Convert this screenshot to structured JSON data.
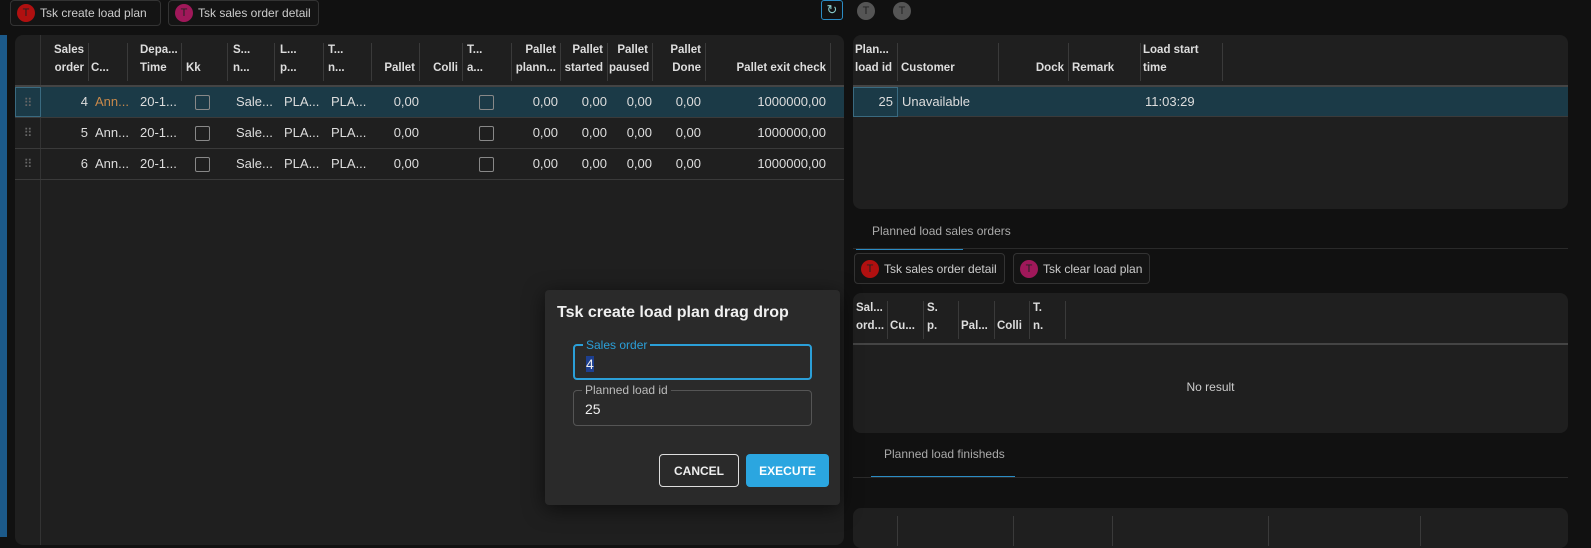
{
  "toolbar": {
    "buttons": [
      {
        "label": "Tsk create load plan",
        "icon_letter": "T",
        "color": "#b01010"
      },
      {
        "label": "Tsk sales order detail",
        "icon_letter": "T",
        "color": "#a0185a"
      }
    ],
    "refresh_icon": "refresh-icon",
    "avatars": [
      "T",
      "T"
    ]
  },
  "sales_orders": {
    "headers": [
      [
        "Sales",
        "order"
      ],
      [
        "",
        "C..."
      ],
      [
        "Depa...",
        "Time"
      ],
      [
        "",
        "Kk"
      ],
      [
        "S...",
        "n..."
      ],
      [
        "L...",
        "p..."
      ],
      [
        "T...",
        "n..."
      ],
      [
        "",
        "Pallet"
      ],
      [
        "",
        "Colli"
      ],
      [
        "T...",
        "a..."
      ],
      [
        "Pallet",
        "plann..."
      ],
      [
        "Pallet",
        "started"
      ],
      [
        "Pallet",
        "paused"
      ],
      [
        "Pallet",
        "Done"
      ],
      [
        "",
        "Pallet exit check"
      ]
    ],
    "rows": [
      {
        "order": "4",
        "customer": "Ann...",
        "time": "20-1...",
        "s": "Sale...",
        "l": "PLA...",
        "t": "PLA...",
        "pallet": "0,00",
        "planned": "0,00",
        "started": "0,00",
        "paused": "0,00",
        "done": "0,00",
        "exit": "1000000,00"
      },
      {
        "order": "5",
        "customer": "Ann...",
        "time": "20-1...",
        "s": "Sale...",
        "l": "PLA...",
        "t": "PLA...",
        "pallet": "0,00",
        "planned": "0,00",
        "started": "0,00",
        "paused": "0,00",
        "done": "0,00",
        "exit": "1000000,00"
      },
      {
        "order": "6",
        "customer": "Ann...",
        "time": "20-1...",
        "s": "Sale...",
        "l": "PLA...",
        "t": "PLA...",
        "pallet": "0,00",
        "planned": "0,00",
        "started": "0,00",
        "paused": "0,00",
        "done": "0,00",
        "exit": "1000000,00"
      }
    ]
  },
  "planned_loads": {
    "headers": [
      [
        "Plan...",
        "load id"
      ],
      [
        "",
        "Customer"
      ],
      [
        "",
        "Dock"
      ],
      [
        "",
        "Remark"
      ],
      [
        "Load start",
        "time"
      ]
    ],
    "rows": [
      {
        "id": "25",
        "customer": "Unavailable",
        "dock": "",
        "remark": "",
        "start": "11:03:29"
      }
    ]
  },
  "tabs": {
    "sales_orders": "Planned load sales orders",
    "finisheds": "Planned load finisheds"
  },
  "sub_buttons": [
    {
      "label": "Tsk sales order detail",
      "icon_letter": "T",
      "color": "#b01010"
    },
    {
      "label": "Tsk clear load plan",
      "icon_letter": "T",
      "color": "#a0185a"
    }
  ],
  "sub_table": {
    "headers": [
      [
        "Sal...",
        "ord..."
      ],
      [
        "",
        "Cu..."
      ],
      [
        "S.",
        "p."
      ],
      [
        "",
        "Pal..."
      ],
      [
        "",
        "Colli"
      ],
      [
        "T.",
        "n."
      ]
    ],
    "empty": "No result"
  },
  "dialog": {
    "title": "Tsk create load plan drag drop",
    "fields": [
      {
        "label": "Sales order",
        "value": "4"
      },
      {
        "label": "Planned load id",
        "value": "25"
      }
    ],
    "cancel": "CANCEL",
    "execute": "EXECUTE"
  }
}
